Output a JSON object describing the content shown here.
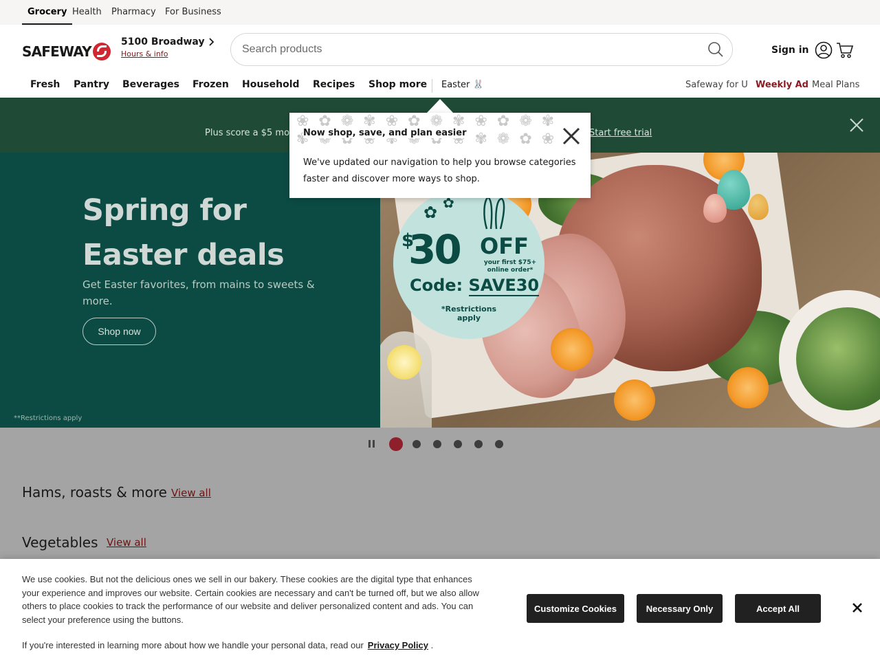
{
  "util_tabs": [
    {
      "label": "Grocery",
      "active": true
    },
    {
      "label": "Health",
      "active": false
    },
    {
      "label": "Pharmacy",
      "active": false
    },
    {
      "label": "For Business",
      "active": false
    }
  ],
  "header": {
    "logo_text": "SAFEWAY",
    "store_name": "5100 Broadway",
    "store_hours_link": "Hours & info",
    "search_placeholder": "Search products",
    "signin_label": "Sign in"
  },
  "nav": {
    "items": [
      "Fresh",
      "Pantry",
      "Beverages",
      "Frozen",
      "Household",
      "Recipes",
      "Shop more"
    ],
    "seasonal": "Easter 🐰",
    "right": [
      "Safeway for U",
      "Weekly Ad",
      "Meal Plans"
    ]
  },
  "promo": {
    "text": "Plus score a $5 mon",
    "link": "Start free trial"
  },
  "hero": {
    "title": "Spring for Easter deals",
    "subtitle": "Get Easter favorites, from mains to sweets & more.",
    "button": "Shop now",
    "restrictions": "**Restrictions apply",
    "coupon": {
      "dollar": "$",
      "amount": "30",
      "off": "OFF",
      "detail": "your first $75+ online order*",
      "code_label": "Code:",
      "code": "SAVE30",
      "terms": "*Restrictions apply"
    }
  },
  "carousel": {
    "slide_count": 6,
    "active_index": 0
  },
  "sections": [
    {
      "title": "Hams, roasts & more",
      "link": "View all"
    },
    {
      "title": "Vegetables",
      "link": "View all"
    }
  ],
  "popover": {
    "title": "Now shop, save, and plan easier",
    "body": "We've updated our navigation to help you browse categories faster and discover more ways to shop."
  },
  "cookie": {
    "text": "We use cookies. But not the delicious ones we sell in our bakery. These cookies are the digital type that enhances your experience and improves our website. Certain cookies are necessary and can't be turned off, but we also allow others to place cookies to track the performance of our website and deliver personalized content and ads. You can select your preference using the buttons.",
    "privacy_prefix": "If you're interested in learning more about how we handle your personal data, read our",
    "privacy_link": "Privacy Policy",
    "privacy_suffix": ".",
    "buttons": [
      "Customize Cookies",
      "Necessary Only",
      "Accept All"
    ]
  },
  "colors": {
    "brand_red": "#d22630",
    "promo_green": "#1f4a36",
    "hero_green": "#0b4b43",
    "active_dot": "#8e1f2b",
    "weekly_ad": "#8a1c22"
  }
}
